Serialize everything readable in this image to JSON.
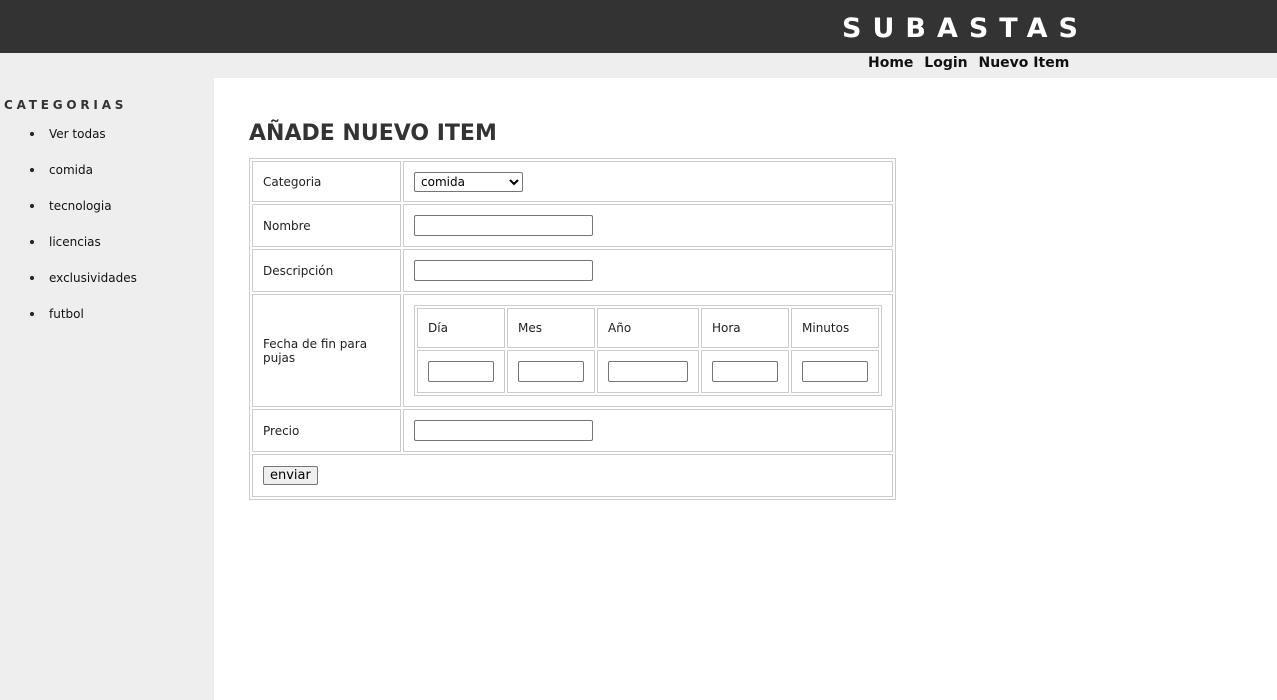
{
  "header": {
    "site_title": "SUBASTAS",
    "background_color": "#333333",
    "title_color": "#ffffff"
  },
  "nav": {
    "items": [
      "Home",
      "Login",
      "Nuevo Item"
    ]
  },
  "sidebar": {
    "title": "CATEGORIAS",
    "items": [
      "Ver todas",
      "comida",
      "tecnologia",
      "licencias",
      "exclusividades",
      "futbol"
    ]
  },
  "form": {
    "title": "AÑADE NUEVO ITEM",
    "categoria_label": "Categoria",
    "categoria_selected": "comida",
    "nombre_label": "Nombre",
    "nombre_value": "",
    "descripcion_label": "Descripción",
    "descripcion_value": "",
    "fecha_label": "Fecha de fin para pujas",
    "fecha_columns": [
      "Día",
      "Mes",
      "Año",
      "Hora",
      "Minutos"
    ],
    "precio_label": "Precio",
    "precio_value": "",
    "submit_label": "enviar"
  },
  "colors": {
    "page_background": "#eeeeee",
    "main_background": "#ffffff",
    "border": "#cccccc"
  }
}
